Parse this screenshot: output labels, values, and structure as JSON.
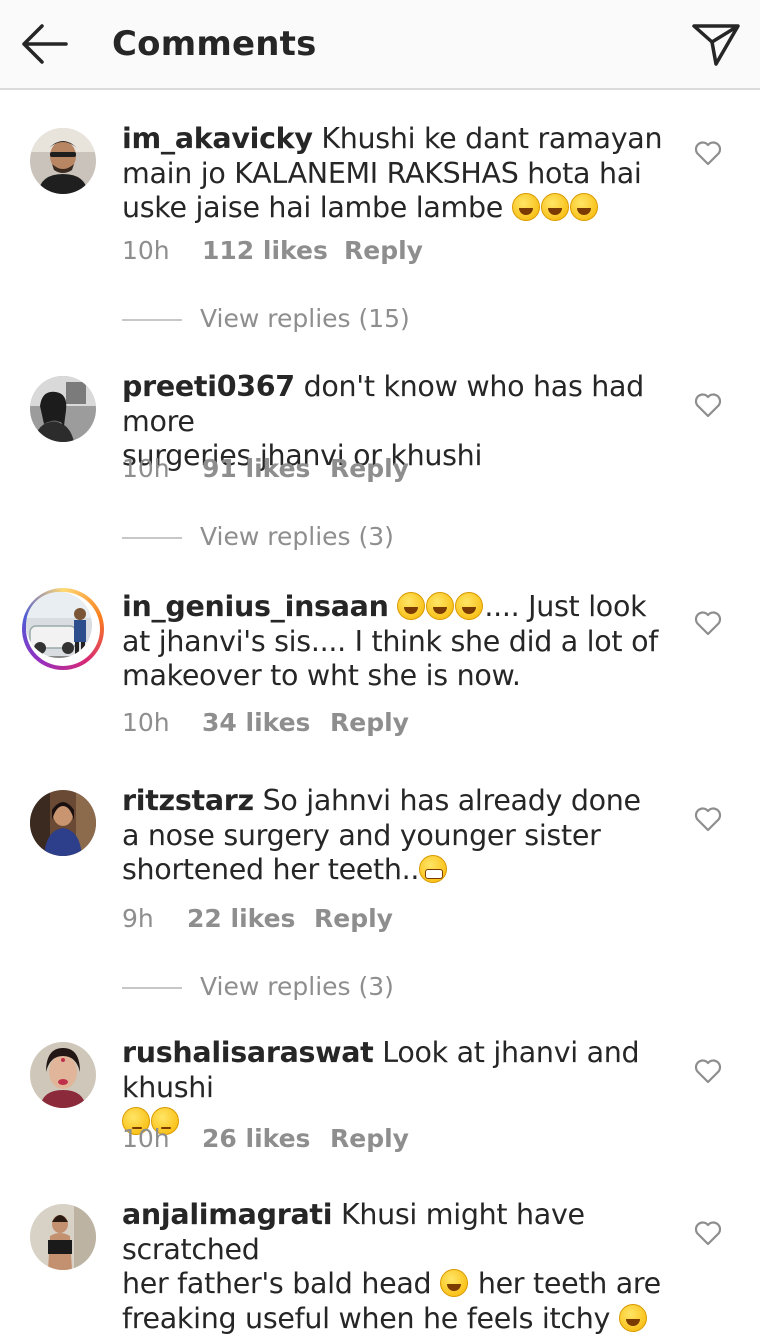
{
  "header": {
    "title": "Comments"
  },
  "comments": [
    {
      "username": "im_akavicky",
      "line1": "Khushi ke dant ramayan",
      "line2": "main jo KALANEMI RAKSHAS hota hai",
      "line3": "uske jaise hai lambe lambe",
      "time": "10h",
      "likes": "112 likes",
      "reply": "Reply",
      "view_replies": "View replies (15)"
    },
    {
      "username": "preeti0367",
      "line1": "don't know who has had more",
      "line2": "surgeries jhanvi or khushi",
      "time": "10h",
      "likes": "91 likes",
      "reply": "Reply",
      "view_replies": "View replies (3)"
    },
    {
      "username": "in_genius_insaan",
      "line1": ".... Just look",
      "line2": "at jhanvi's sis.... I think she did a lot of",
      "line3": "makeover to wht she is now.",
      "time": "10h",
      "likes": "34 likes",
      "reply": "Reply"
    },
    {
      "username": "ritzstarz",
      "line1": "So jahnvi has already done",
      "line2": "a nose surgery and younger sister",
      "line3": "shortened her teeth..",
      "time": "9h",
      "likes": "22 likes",
      "reply": "Reply",
      "view_replies": "View replies (3)"
    },
    {
      "username": "rushalisaraswat",
      "line1": "Look at jhanvi and khushi",
      "time": "10h",
      "likes": "26 likes",
      "reply": "Reply"
    },
    {
      "username": "anjalimagrati",
      "line1": "Khusi might have scratched",
      "line2": "her father's bald head",
      "line2b": "her teeth are",
      "line3": "freaking useful when he feels itchy"
    }
  ],
  "colors": {
    "muted": "#8e8e8e",
    "text": "#262626",
    "header_bg": "#fafafa",
    "emoji": "#f7b500"
  },
  "icons": {
    "back": "arrow-left-icon",
    "send": "paper-plane-icon",
    "like": "heart-outline-icon",
    "laugh": "tears-of-joy-emoji",
    "grin": "grimacing-emoji",
    "eyeroll": "eye-roll-emoji"
  }
}
